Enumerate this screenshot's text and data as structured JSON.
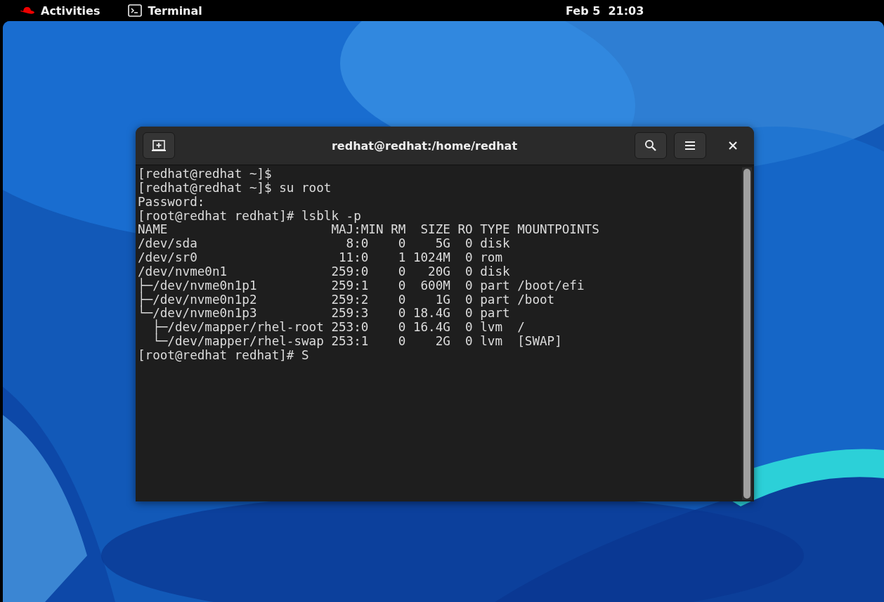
{
  "top_bar": {
    "activities": "Activities",
    "app_name": "Terminal",
    "clock": "Feb 5  21:03"
  },
  "window": {
    "title": "redhat@redhat:/home/redhat"
  },
  "terminal": {
    "lines": [
      "[redhat@redhat ~]$",
      "[redhat@redhat ~]$ su root",
      "Password:",
      "[root@redhat redhat]# lsblk -p",
      "NAME                      MAJ:MIN RM  SIZE RO TYPE MOUNTPOINTS",
      "/dev/sda                    8:0    0    5G  0 disk",
      "/dev/sr0                   11:0    1 1024M  0 rom",
      "/dev/nvme0n1              259:0    0   20G  0 disk",
      "├─/dev/nvme0n1p1          259:1    0  600M  0 part /boot/efi",
      "├─/dev/nvme0n1p2          259:2    0    1G  0 part /boot",
      "└─/dev/nvme0n1p3          259:3    0 18.4G  0 part",
      "  ├─/dev/mapper/rhel-root 253:0    0 16.4G  0 lvm  /",
      "  └─/dev/mapper/rhel-swap 253:1    0    2G  0 lvm  [SWAP]",
      "[root@redhat redhat]# S"
    ]
  }
}
